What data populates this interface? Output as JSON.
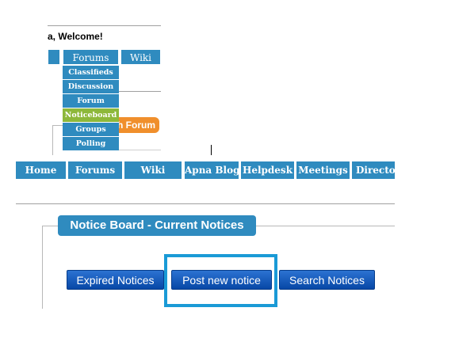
{
  "header": {
    "welcome_text": "a, Welcome!"
  },
  "top_nav": {
    "items": [
      "",
      "Forums",
      "Wiki"
    ]
  },
  "forums_dropdown": {
    "items": [
      "Classifieds",
      "Discussion",
      "Forum",
      "Noticeboard",
      "Groups",
      "Polling Booth"
    ],
    "active": "Noticeboard"
  },
  "partial_tab": {
    "label": "h Forum"
  },
  "main_nav": {
    "items": [
      "Home",
      "Forums",
      "Wiki",
      "Apna Blog",
      "Helpdesk",
      "Meetings",
      "Directo"
    ]
  },
  "notice_board": {
    "title": "Notice Board - Current Notices",
    "buttons": {
      "expired": "Expired Notices",
      "post_new": "Post new notice",
      "search": "Search Notices"
    }
  },
  "colors": {
    "nav_blue": "#2f8bbf",
    "active_green": "#8db83a",
    "tab_orange": "#f08f2c",
    "button_blue": "#0a55b8",
    "highlight_cyan": "#1a9ad6"
  }
}
